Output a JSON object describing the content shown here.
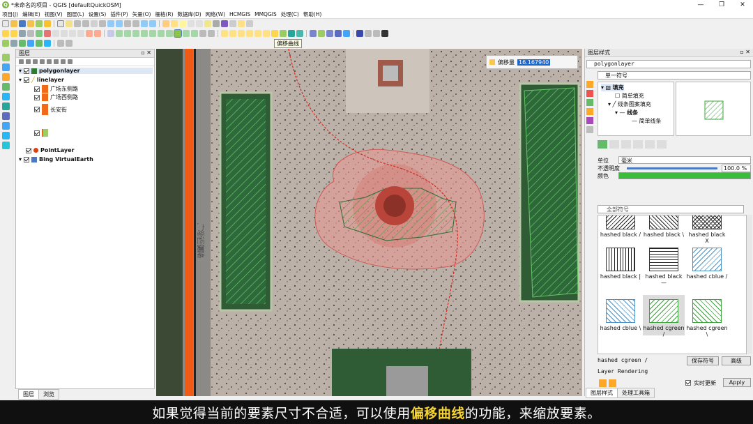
{
  "window": {
    "title": "*未命名的项目 - QGIS [defaultQuickOSM]",
    "app_icon": "Q",
    "minimize": "—",
    "maximize": "❐",
    "close": "✕"
  },
  "menu": [
    "项目(J)",
    "编辑(E)",
    "视图(V)",
    "图层(L)",
    "设置(S)",
    "插件(P)",
    "矢量(O)",
    "栅格(R)",
    "数据库(D)",
    "网络(W)",
    "HCMGIS",
    "MMQGIS",
    "处理(C)",
    "帮助(H)"
  ],
  "toolbar": {
    "tooltip": "偏移曲线"
  },
  "layers_panel": {
    "title": "图层",
    "layers": [
      {
        "name": "polygonlayer",
        "checked": true
      },
      {
        "name": "linelayer",
        "checked": true
      },
      {
        "name": "广场东侧路",
        "checked": true
      },
      {
        "name": "广场西侧路",
        "checked": true
      },
      {
        "name": "长安街",
        "checked": true
      },
      {
        "name": "PointLayer",
        "checked": true
      },
      {
        "name": "Bing VirtualEarth",
        "checked": true
      }
    ],
    "tabs": [
      "图层",
      "浏览"
    ]
  },
  "map": {
    "offset_label": "偏移量",
    "offset_value": "16.167940",
    "road_label": "广场西侧路"
  },
  "style_panel": {
    "title": "图层样式",
    "layer_select": "polygonlayer",
    "renderer": "单一符号",
    "tree": [
      "填充",
      "简单填充",
      "线条图案填充",
      "线条",
      "简单线条"
    ],
    "unit_label": "单位",
    "unit_value": "毫米",
    "opacity_label": "不透明度",
    "opacity_value": "100.0 %",
    "color_label": "颜色",
    "search_placeholder": "全部符号",
    "symbols": [
      "hashed black /",
      "hashed black \\",
      "hashed black X",
      "hashed black |",
      "hashed black —",
      "hashed cblue /",
      "hashed cblue \\",
      "hashed cgreen /",
      "hashed cgreen \\"
    ],
    "current_symbol": "hashed cgreen /",
    "save_symbol": "保存符号",
    "advanced": "高级",
    "layer_rendering": "Layer Rendering",
    "live_update": "实时更新",
    "apply": "Apply",
    "bottom_tabs": [
      "图层样式",
      "处理工具箱"
    ],
    "colors": {
      "fill_green": "#3cbc3c",
      "highlight": "#1e66c8"
    }
  },
  "subtitle": {
    "before": "如果觉得当前的要素尺寸不合适，可以使用",
    "highlight": "偏移曲线",
    "after": "的功能，来缩放要素。"
  }
}
